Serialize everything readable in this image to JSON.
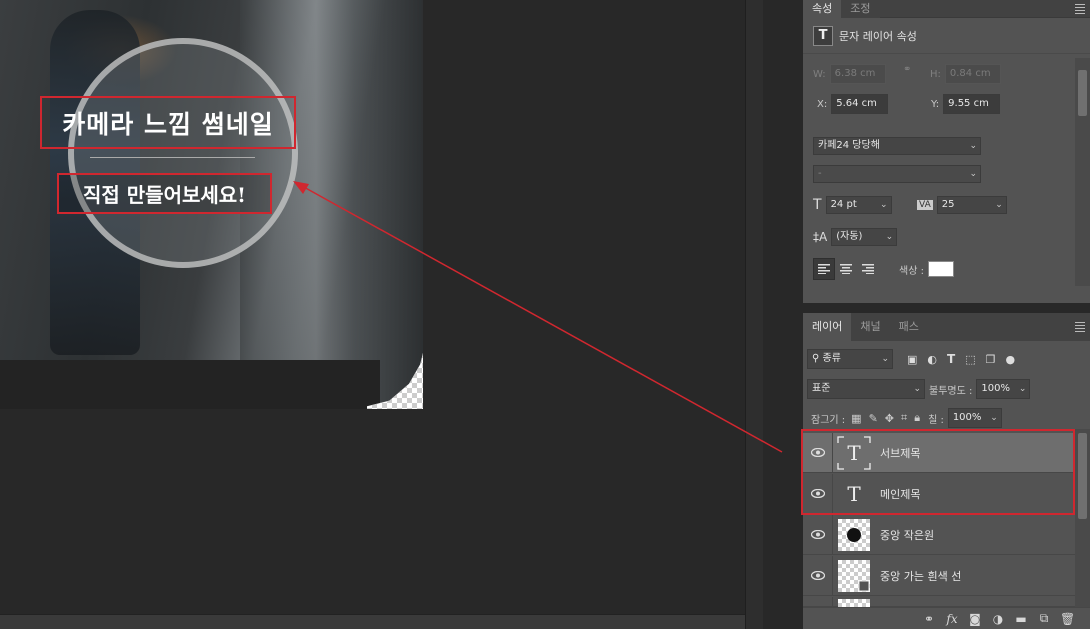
{
  "canvas": {
    "main_title": "카메라 느낌 썸네일",
    "sub_title": "직접 만들어보세요!",
    "colors": {
      "highlight": "#d0272f",
      "panel_bg": "#535353",
      "canvas_bg": "#282828"
    }
  },
  "properties_panel": {
    "tabs": [
      {
        "label": "속성",
        "active": true
      },
      {
        "label": "조정",
        "active": false
      }
    ],
    "header_label": "문자 레이어 속성",
    "header_icon_glyph": "T",
    "w_label": "W:",
    "w_value": "6.38 cm",
    "h_label": "H:",
    "h_value": "0.84 cm",
    "x_label": "X:",
    "x_value": "5.64 cm",
    "y_label": "Y:",
    "y_value": "9.55 cm",
    "font_family": "카페24 당당해",
    "font_style": "-",
    "font_size": "24 pt",
    "tracking": "25",
    "leading": "(자동)",
    "color_label": "색상 :",
    "text_color": "#ffffff"
  },
  "layers_panel": {
    "tabs": [
      {
        "label": "레이어",
        "active": true
      },
      {
        "label": "채널",
        "active": false
      },
      {
        "label": "패스",
        "active": false
      }
    ],
    "filter_kind": "종류",
    "blend_mode": "표준",
    "opacity_label": "불투명도 :",
    "opacity_value": "100%",
    "lock_label": "잠그기 :",
    "fill_label": "칠 :",
    "fill_value": "100%",
    "layers": [
      {
        "name": "서브제목",
        "type": "text",
        "selected": true
      },
      {
        "name": "메인제목",
        "type": "text",
        "selected": false
      },
      {
        "name": "중앙 작은원",
        "type": "shape-circle",
        "selected": false
      },
      {
        "name": "중앙 가는 흰색 선",
        "type": "shape-line",
        "selected": false
      }
    ],
    "bottom_icons": [
      "link-icon",
      "fx-icon",
      "mask-icon",
      "adjustment-icon",
      "folder-icon",
      "new-layer-icon",
      "trash-icon"
    ]
  }
}
